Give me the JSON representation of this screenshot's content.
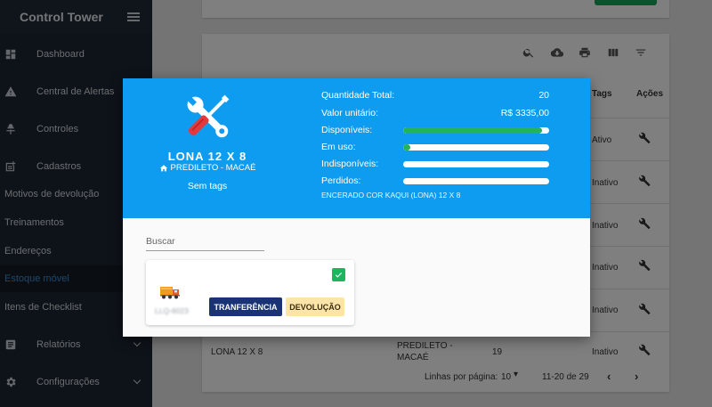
{
  "sidebar": {
    "title": "Control Tower",
    "items": [
      {
        "label": "Dashboard",
        "icon": "dashboard-icon"
      },
      {
        "label": "Central de Alertas",
        "icon": "warning-icon"
      },
      {
        "label": "Controles",
        "icon": "control-icon"
      },
      {
        "label": "Cadastros",
        "icon": "add-note-icon"
      },
      {
        "label": "Relatórios",
        "icon": "report-icon"
      },
      {
        "label": "Configurações",
        "icon": "gear-icon"
      }
    ],
    "subitems": [
      {
        "label": "Motivos de devolução"
      },
      {
        "label": "Treinamentos"
      },
      {
        "label": "Endereços"
      },
      {
        "label": "Estoque móvel",
        "active": true
      },
      {
        "label": "Itens de Checklist"
      }
    ]
  },
  "table": {
    "columns": {
      "tags": "Tags",
      "actions": "Ações"
    },
    "rows": [
      {
        "tag": "Ativo"
      },
      {
        "tag": "Inativo"
      },
      {
        "tag": "Inativo"
      },
      {
        "tag": "Inativo"
      },
      {
        "tag": "Inativo"
      },
      {
        "name": "LONA 12 X 8",
        "location_line1": "PREDILETO -",
        "location_line2": "MACAÉ",
        "qty": "19",
        "tag": "Inativo"
      }
    ],
    "pager": {
      "rows_label": "Linhas por página:",
      "rows_value": "10",
      "range": "11-20 de 29"
    }
  },
  "modal": {
    "title": "LONA 12 X 8",
    "location": "PREDILETO - MACAÉ",
    "tags": "Sem tags",
    "stats": {
      "total_label": "Quantidade Total:",
      "total_value": "20",
      "unit_label": "Valor unitário:",
      "unit_value": "R$ 3335,00",
      "available_label": "Disponíveis:",
      "in_use_label": "Em uso:",
      "unavailable_label": "Indisponíveis:",
      "lost_label": "Perdidos:"
    },
    "bars": {
      "available": 0.95,
      "in_use": 0.05,
      "unavailable": 0,
      "lost": 0
    },
    "description": "ENCERADO COR KAQUI (LONA) 12 X 8",
    "search_placeholder": "Buscar",
    "item": {
      "plate": "LLQ-6023",
      "transfer_label": "TRANFERÊNCIA",
      "return_label": "DEVOLUÇÃO"
    }
  },
  "colors": {
    "header_blue": "#0d9cf0",
    "progress_green": "#22b35f",
    "transfer_navy": "#1a3374",
    "return_yellow": "#fde4a8",
    "sidebar_bg": "#1d2733",
    "active_link": "#3b8fd8"
  }
}
